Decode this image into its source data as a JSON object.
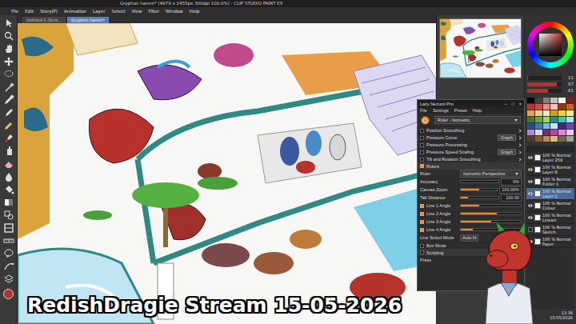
{
  "window": {
    "title": "Gryphon harem* (4879 x 2455px 300dpi 100.0%) - CLIP STUDIO PAINT EX"
  },
  "menu": [
    "File",
    "Edit",
    "Story(P)",
    "Animation",
    "Layer",
    "Select",
    "View",
    "Filter",
    "Window",
    "Help"
  ],
  "doc_tabs": [
    {
      "label": "Untitled-1 (Scre...",
      "selected": false
    },
    {
      "label": "Gryphon harem*",
      "selected": true
    }
  ],
  "color": {
    "current": "#b8322c",
    "sliders": [
      {
        "value": "11",
        "level": 0.03
      },
      {
        "value": "87",
        "level": 0.87
      },
      {
        "value": "61",
        "level": 0.61
      }
    ]
  },
  "swatches": [
    "#000000",
    "#404040",
    "#808080",
    "#bfbfbf",
    "#ffffff",
    "#7a1f1f",
    "#b8322c",
    "#e0463a",
    "#f08a7a",
    "#f6c3b6",
    "#8a3b12",
    "#c9652a",
    "#e9a14a",
    "#f4cf8a",
    "#f7e9b8",
    "#c9a227",
    "#e8d24a",
    "#f3ee8c",
    "#3f7a2a",
    "#5fae3a",
    "#9fd66a",
    "#2f8a84",
    "#4fc0b5",
    "#a8e6df",
    "#1f4e8a",
    "#3a7ac0",
    "#7fb5e6",
    "#bfe6f2",
    "#3a2a7a",
    "#6a4ab0",
    "#a58ad8",
    "#d9d6f0",
    "#7a2a6a",
    "#b04a9a",
    "#e08ad0",
    "#f3c6ea",
    "#5a3a2a",
    "#8a5a3a",
    "#b88a5a",
    "#d9b88a",
    "#6a6a5a",
    "#a0a090"
  ],
  "layers": [
    {
      "mode": "100 % Normal",
      "name": "Layer 259",
      "visible": true,
      "selected": false
    },
    {
      "mode": "100 % Normal",
      "name": "Layer 8",
      "visible": true,
      "selected": false
    },
    {
      "mode": "100 % Normal",
      "name": "Folder 1",
      "visible": true,
      "selected": false
    },
    {
      "mode": "100 % Normal",
      "name": "Layer 1",
      "visible": true,
      "selected": true
    },
    {
      "mode": "100 % Normal",
      "name": "Colour",
      "visible": true,
      "selected": false
    },
    {
      "mode": "100 % Normal",
      "name": "Lineart",
      "visible": true,
      "selected": false
    },
    {
      "mode": "100 % Normal",
      "name": "Sketch",
      "visible": false,
      "selected": false
    },
    {
      "mode": "100 % Normal",
      "name": "Paper",
      "visible": true,
      "selected": false
    }
  ],
  "clock": {
    "time": "13:38",
    "date": "15/05/2026"
  },
  "lazy_nezumi": {
    "title": "Lazy Nezumi Pro",
    "controls": [
      "–",
      "□",
      "×"
    ],
    "menu": [
      "File",
      "Settings",
      "Preset",
      "Help"
    ],
    "power_on": true,
    "preset": "Ruler - Isometric",
    "options": [
      {
        "label": "Position Smoothing",
        "checked": false,
        "kind": "plain"
      },
      {
        "label": "Pressure Curve",
        "checked": false,
        "kind": "graph",
        "button": "Graph"
      },
      {
        "label": "Pressure Processing",
        "checked": false,
        "kind": "plain"
      },
      {
        "label": "Pressure Speed Scaling",
        "checked": false,
        "kind": "graph",
        "button": "Graph"
      },
      {
        "label": "Tilt and Rotation Smoothing",
        "checked": false,
        "kind": "plain"
      }
    ],
    "rulers": {
      "label": "Rulers",
      "checked": true
    },
    "fields": [
      {
        "label": "Ruler",
        "value": "Isometric Perspective",
        "kind": "dropdown"
      },
      {
        "label": "Accuracy",
        "value": "0%",
        "kind": "slider",
        "level": 0
      },
      {
        "label": "Canvas Zoom",
        "value": "100.00%",
        "kind": "slider",
        "level": 0.5
      },
      {
        "label": "Tab Distance",
        "value": "100.00",
        "kind": "slider",
        "level": 0.2
      }
    ],
    "lines": [
      {
        "label": "Line 1 Angle",
        "checked": true,
        "level": 0.3
      },
      {
        "label": "Line 2 Angle",
        "checked": true,
        "level": 0.6
      },
      {
        "label": "Line 3 Angle",
        "checked": true,
        "level": 0.5
      },
      {
        "label": "Line 4 Angle",
        "checked": true,
        "level": 0.2
      }
    ],
    "line_select": {
      "label": "Line Select Mode",
      "value": "Auto Id"
    },
    "box_mode": {
      "label": "Box Mode",
      "checked": false
    },
    "scripting": {
      "label": "Scripting",
      "checked": false
    },
    "footer": "Press"
  },
  "overlay": {
    "title": "RedishDragie Stream 15-05-2026"
  }
}
